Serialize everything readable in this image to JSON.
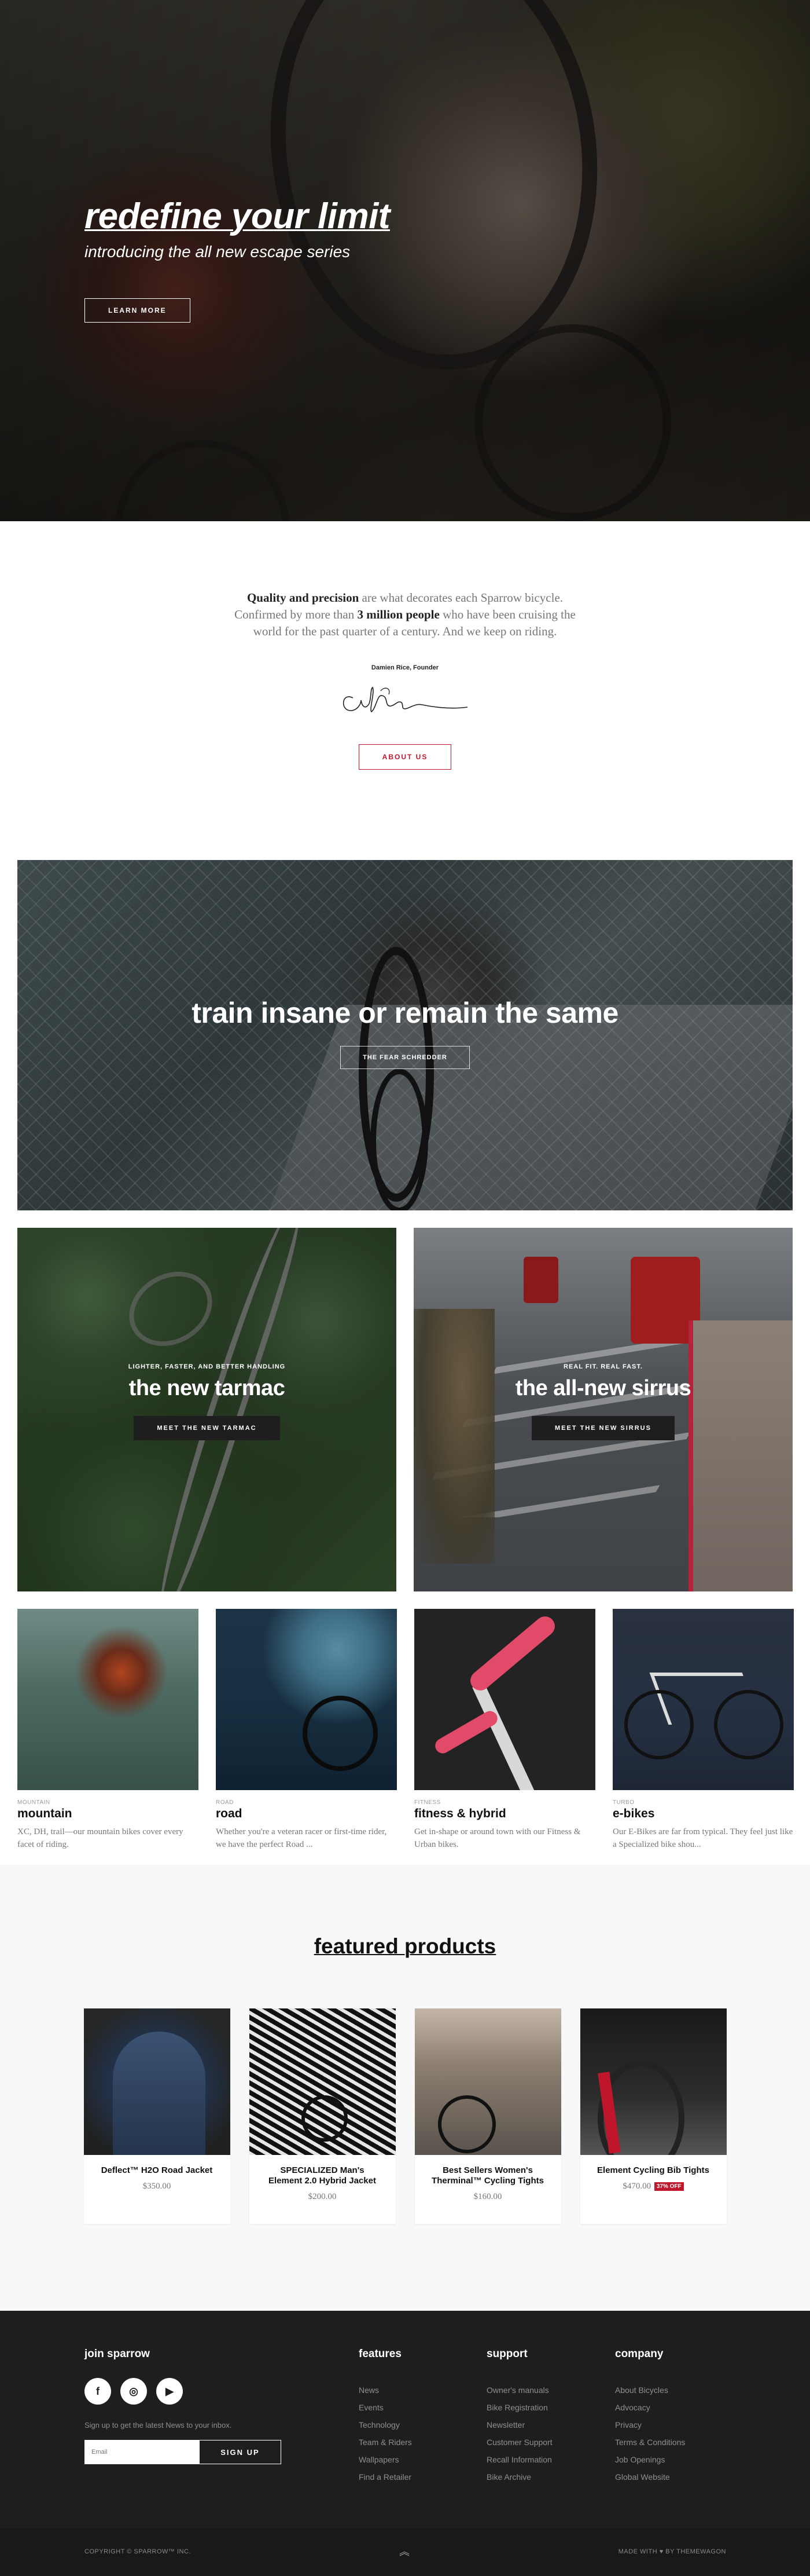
{
  "hero": {
    "title": "redefine your limit",
    "subtitle": "introducing the all new escape series",
    "button": "LEARN MORE"
  },
  "about": {
    "quote_bold1": "Quality and precision",
    "quote_mid1": " are what decorates each Sparrow bicycle. Confirmed by more than ",
    "quote_bold2": "3 million people",
    "quote_mid2": " who have been cruising the world for the past quarter of a century. And we keep on riding.",
    "founder": "Damien Rice, Founder",
    "button": "ABOUT US"
  },
  "banner": {
    "title": "train insane or remain the same",
    "button": "THE FEAR SCHREDDER"
  },
  "promos": [
    {
      "eyebrow": "LIGHTER, FASTER, AND BETTER HANDLING",
      "title": "the new tarmac",
      "button": "MEET THE NEW TARMAC"
    },
    {
      "eyebrow": "REAL FIT. REAL FAST.",
      "title": "the all-new sirrus",
      "button": "MEET THE NEW SIRRUS"
    }
  ],
  "categories": [
    {
      "label": "MOUNTAIN",
      "title": "mountain",
      "desc": "XC, DH, trail—our mountain bikes cover every facet of riding."
    },
    {
      "label": "ROAD",
      "title": "road",
      "desc": "Whether you're a veteran racer or first-time rider, we have the perfect Road ..."
    },
    {
      "label": "FITNESS",
      "title": "fitness & hybrid",
      "desc": "Get in-shape or around town with our Fitness & Urban bikes."
    },
    {
      "label": "TURBO",
      "title": "e-bikes",
      "desc": "Our E-Bikes are far from typical. They feel just like a Specialized bike shou..."
    }
  ],
  "featured": {
    "title": "featured products",
    "products": [
      {
        "name": "Deflect™ H2O Road Jacket",
        "price": "$350.00"
      },
      {
        "name": "SPECIALIZED Man's Element 2.0 Hybrid Jacket",
        "price": "$200.00"
      },
      {
        "name": "Best Sellers Women's Therminal™ Cycling Tights",
        "price": "$160.00"
      },
      {
        "name": "Element Cycling Bib Tights",
        "price": "$470.00",
        "badge": "37% OFF"
      }
    ]
  },
  "footer": {
    "join": {
      "title": "join sparrow",
      "note": "Sign up to get the latest News to your inbox.",
      "email_placeholder": "Email",
      "signup": "SIGN UP",
      "social": [
        {
          "icon": "facebook-icon",
          "glyph": "f"
        },
        {
          "icon": "instagram-icon",
          "glyph": "◎"
        },
        {
          "icon": "youtube-icon",
          "glyph": "▶"
        }
      ]
    },
    "columns": [
      {
        "title": "features",
        "links": [
          "News",
          "Events",
          "Technology",
          "Team & Riders",
          "Wallpapers",
          "Find a Retailer"
        ]
      },
      {
        "title": "support",
        "links": [
          "Owner's manuals",
          "Bike Registration",
          "Newsletter",
          "Customer Support",
          "Recall Information",
          "Bike Archive"
        ]
      },
      {
        "title": "company",
        "links": [
          "About Bicycles",
          "Advocacy",
          "Privacy",
          "Terms & Conditions",
          "Job Openings",
          "Global Website"
        ]
      }
    ],
    "copyright": "COPYRIGHT © SPARROW™ INC.",
    "made_with": "MADE WITH ♥ BY THEMEWAGON",
    "back_to_top": "︽"
  },
  "colors": {
    "accent": "#c0162c",
    "footer_bg": "#1e1e1e"
  }
}
